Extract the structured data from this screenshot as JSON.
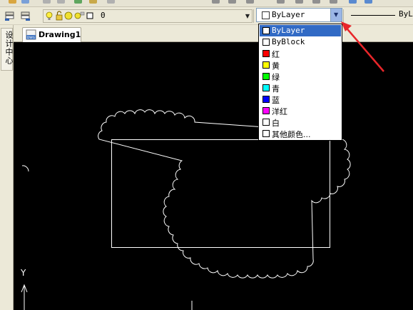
{
  "layer_toolbar": {
    "layer_name": "0"
  },
  "color_control": {
    "current_value": "ByLayer",
    "options": [
      {
        "label": "ByLayer",
        "swatch": "#ffffff",
        "selected": true
      },
      {
        "label": "ByBlock",
        "swatch": "#ffffff",
        "selected": false
      },
      {
        "label": "红",
        "swatch": "#ff0000",
        "selected": false
      },
      {
        "label": "黄",
        "swatch": "#ffff00",
        "selected": false
      },
      {
        "label": "绿",
        "swatch": "#00ff00",
        "selected": false
      },
      {
        "label": "青",
        "swatch": "#00ffff",
        "selected": false
      },
      {
        "label": "蓝",
        "swatch": "#0000ff",
        "selected": false
      },
      {
        "label": "洋红",
        "swatch": "#ff00ff",
        "selected": false
      },
      {
        "label": "白",
        "swatch": "#ffffff",
        "selected": false
      },
      {
        "label": "其他颜色...",
        "swatch": "#ffffff",
        "selected": false
      }
    ]
  },
  "linetype_control": {
    "value": "ByLayer"
  },
  "left_panel": {
    "design_center_label": "设计中心"
  },
  "document_tabs": {
    "active": "Drawing1",
    "icon_text": "DWG"
  },
  "canvas": {
    "background": "#000000",
    "ucs_y_label": "Y"
  },
  "colors": {
    "selection": "#316ac5",
    "annotation_arrow": "#e8262a",
    "dropdown_button": "#9bb6e6"
  }
}
